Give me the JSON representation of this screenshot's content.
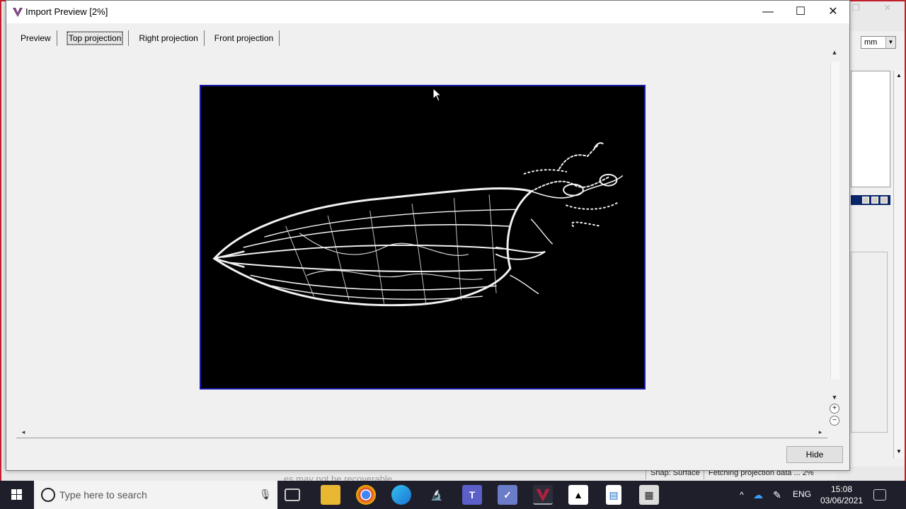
{
  "background_app": {
    "units_value": "mm",
    "status_snap": "Snap: Surface",
    "status_fetch": "Fetching projection data ... 2%",
    "caption": "...es may not be recoverable"
  },
  "dialog": {
    "title": "Import Preview [2%]",
    "tabs": [
      {
        "label": "Preview",
        "active": false
      },
      {
        "label": "Top projection",
        "active": true
      },
      {
        "label": "Right projection",
        "active": false
      },
      {
        "label": "Front projection",
        "active": false
      }
    ],
    "hide_label": "Hide",
    "image_description_icon": "ct-scan-projection"
  },
  "taskbar": {
    "search_placeholder": "Type here to search",
    "language": "ENG",
    "time": "15:08",
    "date": "03/06/2021",
    "pinned_icons": [
      "task-view-icon",
      "file-explorer-icon",
      "chrome-icon",
      "edge-icon",
      "microscope-app-icon",
      "teams-icon",
      "checkmark-app-icon",
      "v-app-icon",
      "photos-icon",
      "document-icon",
      "calculator-icon"
    ]
  },
  "colors": {
    "frame_red": "#c0202b",
    "image_border": "#1a1aa8",
    "taskbar_bg": "#1f1f2b"
  }
}
